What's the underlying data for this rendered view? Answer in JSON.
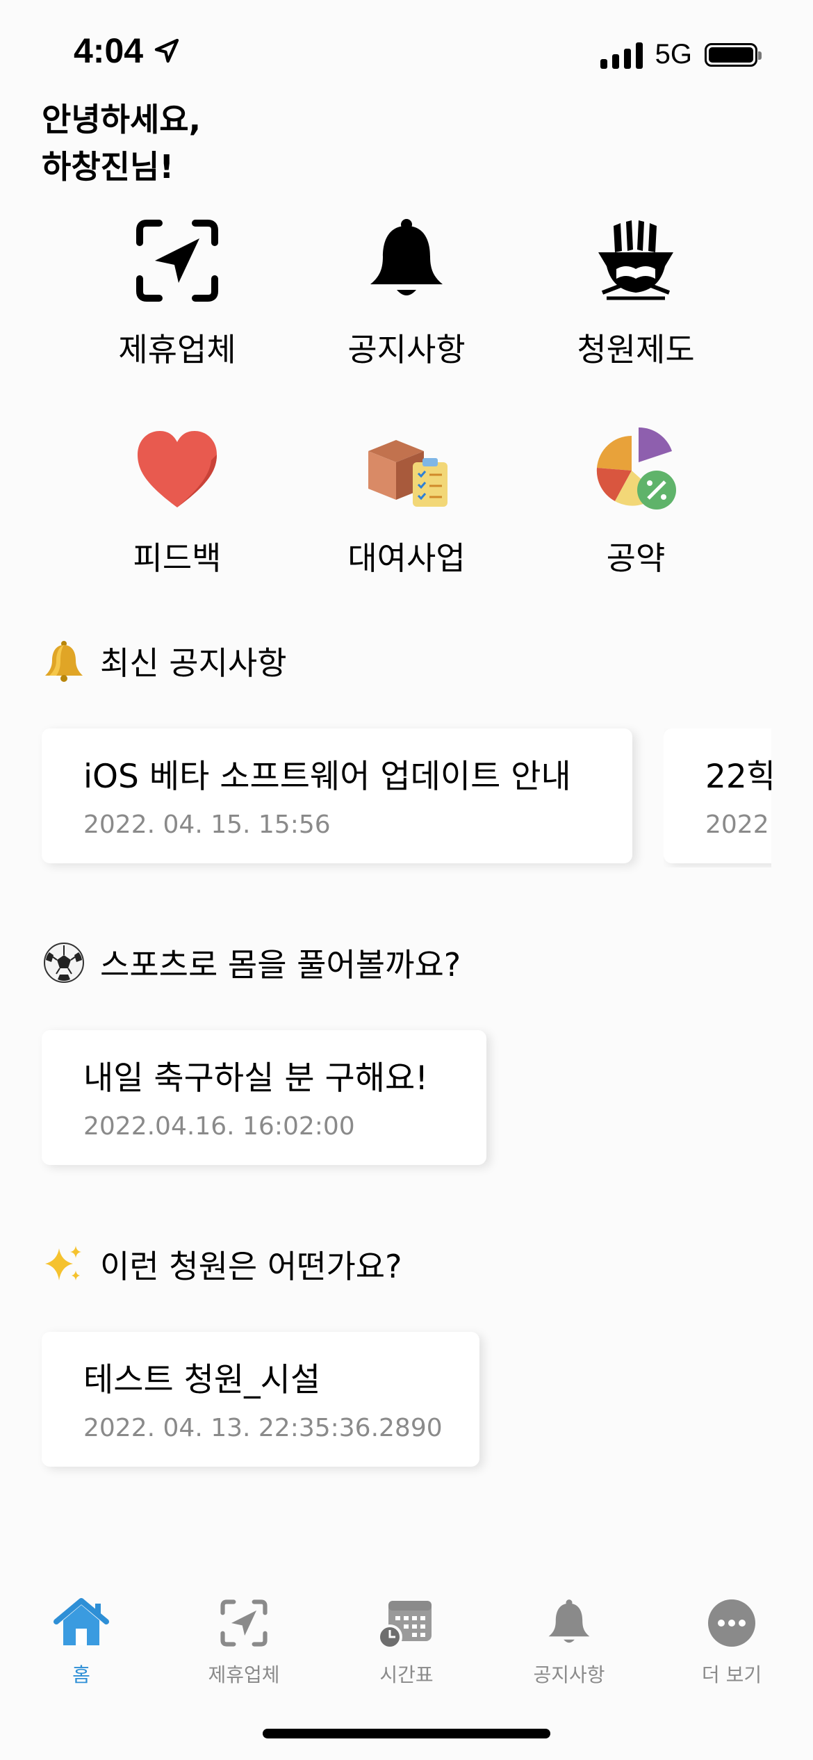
{
  "status_bar": {
    "time": "4:04",
    "network": "5G"
  },
  "greeting": {
    "line1": "안녕하세요,",
    "line2": "하창진님!"
  },
  "menu": [
    {
      "label": "제휴업체",
      "icon": "partner-location-icon"
    },
    {
      "label": "공지사항",
      "icon": "bell-icon"
    },
    {
      "label": "청원제도",
      "icon": "petition-book-icon"
    },
    {
      "label": "피드백",
      "icon": "heart-icon"
    },
    {
      "label": "대여사업",
      "icon": "rental-box-icon"
    },
    {
      "label": "공약",
      "icon": "pie-chart-percent-icon"
    }
  ],
  "notices": {
    "title": "최신 공지사항",
    "items": [
      {
        "title": "iOS 베타 소프트웨어 업데이트 안내",
        "date": "2022. 04. 15. 15:56"
      },
      {
        "title": "22학",
        "date": "2022."
      }
    ]
  },
  "sports": {
    "title": "스포츠로 몸을 풀어볼까요?",
    "items": [
      {
        "title": "내일 축구하실 분 구해요!",
        "date": "2022.04.16. 16:02:00"
      }
    ]
  },
  "petitions": {
    "title": "이런 청원은 어떤가요?",
    "items": [
      {
        "title": "테스트 청원_시설",
        "date": "2022. 04. 13. 22:35:36.2890"
      }
    ]
  },
  "tabbar": {
    "items": [
      {
        "label": "홈",
        "icon": "home-icon",
        "active": true
      },
      {
        "label": "제휴업체",
        "icon": "partner-location-icon",
        "active": false
      },
      {
        "label": "시간표",
        "icon": "calendar-clock-icon",
        "active": false
      },
      {
        "label": "공지사항",
        "icon": "bell-icon",
        "active": false
      },
      {
        "label": "더 보기",
        "icon": "more-icon",
        "active": false
      }
    ]
  },
  "colors": {
    "accent": "#2e8fd6",
    "inactive": "#8a8a8a",
    "heart": "#e85a4f"
  }
}
